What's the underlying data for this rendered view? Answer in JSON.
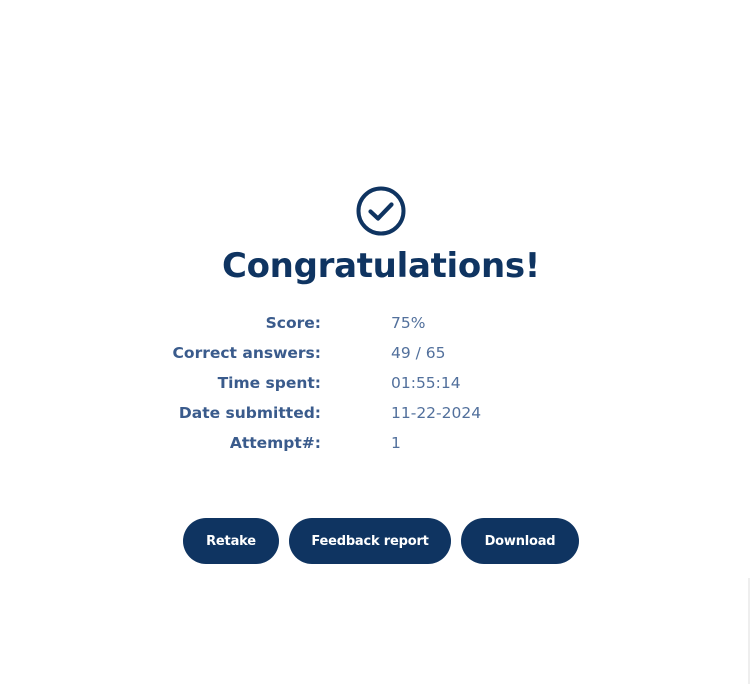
{
  "result": {
    "title": "Congratulations!",
    "icon": "check-circle-icon",
    "accent_color": "#0f3461",
    "stats": [
      {
        "label": "Score:",
        "value": "75%"
      },
      {
        "label": "Correct answers:",
        "value": "49 / 65"
      },
      {
        "label": "Time spent:",
        "value": "01:55:14"
      },
      {
        "label": "Date submitted:",
        "value": "11-22-2024"
      },
      {
        "label": "Attempt#:",
        "value": "1"
      }
    ]
  },
  "actions": {
    "retake_label": "Retake",
    "feedback_label": "Feedback report",
    "download_label": "Download"
  }
}
